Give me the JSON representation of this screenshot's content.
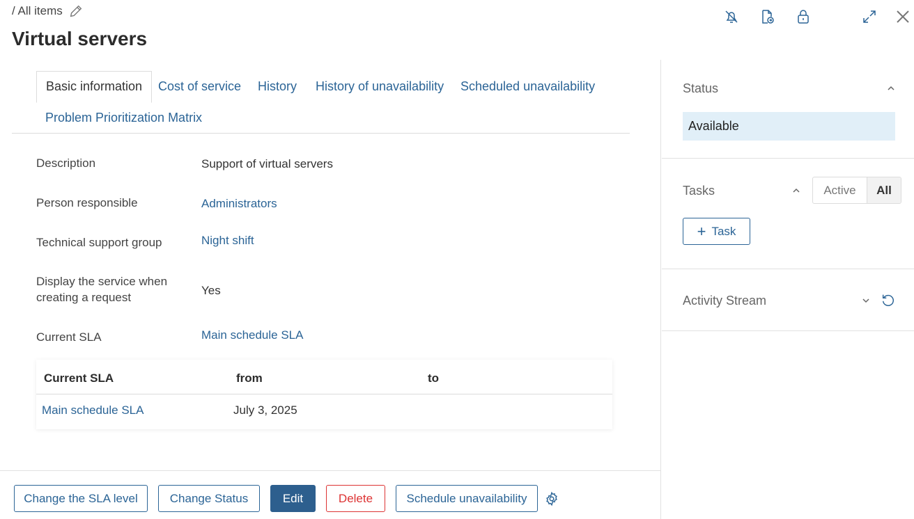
{
  "breadcrumb": {
    "text": "/ All items"
  },
  "page": {
    "title": "Virtual servers"
  },
  "tabs": [
    {
      "label": "Basic information"
    },
    {
      "label": "Cost of service"
    },
    {
      "label": "History"
    },
    {
      "label": "History of unavailability"
    },
    {
      "label": "Scheduled unavailability"
    },
    {
      "label": "Problem Prioritization Matrix"
    }
  ],
  "fields": {
    "description": {
      "label": "Description",
      "value": "Support of virtual servers"
    },
    "person": {
      "label": "Person responsible",
      "value": "Administrators"
    },
    "group": {
      "label": "Technical support group",
      "value": "Night shift"
    },
    "display": {
      "label_line1": "Display the service when",
      "label_line2": "creating a request",
      "value": "Yes"
    },
    "sla": {
      "label": "Current SLA",
      "value": "Main schedule SLA"
    }
  },
  "sla_table": {
    "headers": [
      "Current SLA",
      "from",
      "to"
    ],
    "rows": [
      {
        "sla": "Main schedule SLA",
        "from": "July 3, 2025",
        "to": ""
      }
    ]
  },
  "actions": {
    "change_sla": "Change the SLA level",
    "change_status": "Change Status",
    "edit": "Edit",
    "delete": "Delete",
    "schedule": "Schedule unavailability"
  },
  "sidebar": {
    "status_title": "Status",
    "status_value": "Available",
    "tasks_title": "Tasks",
    "filter_active": "Active",
    "filter_all": "All",
    "task_button": "Task",
    "activity_title": "Activity Stream"
  },
  "colors": {
    "accent": "#2b6496",
    "primary_button": "#2d5f8e",
    "danger": "#dd3333",
    "status_bg": "#e1eff8"
  }
}
